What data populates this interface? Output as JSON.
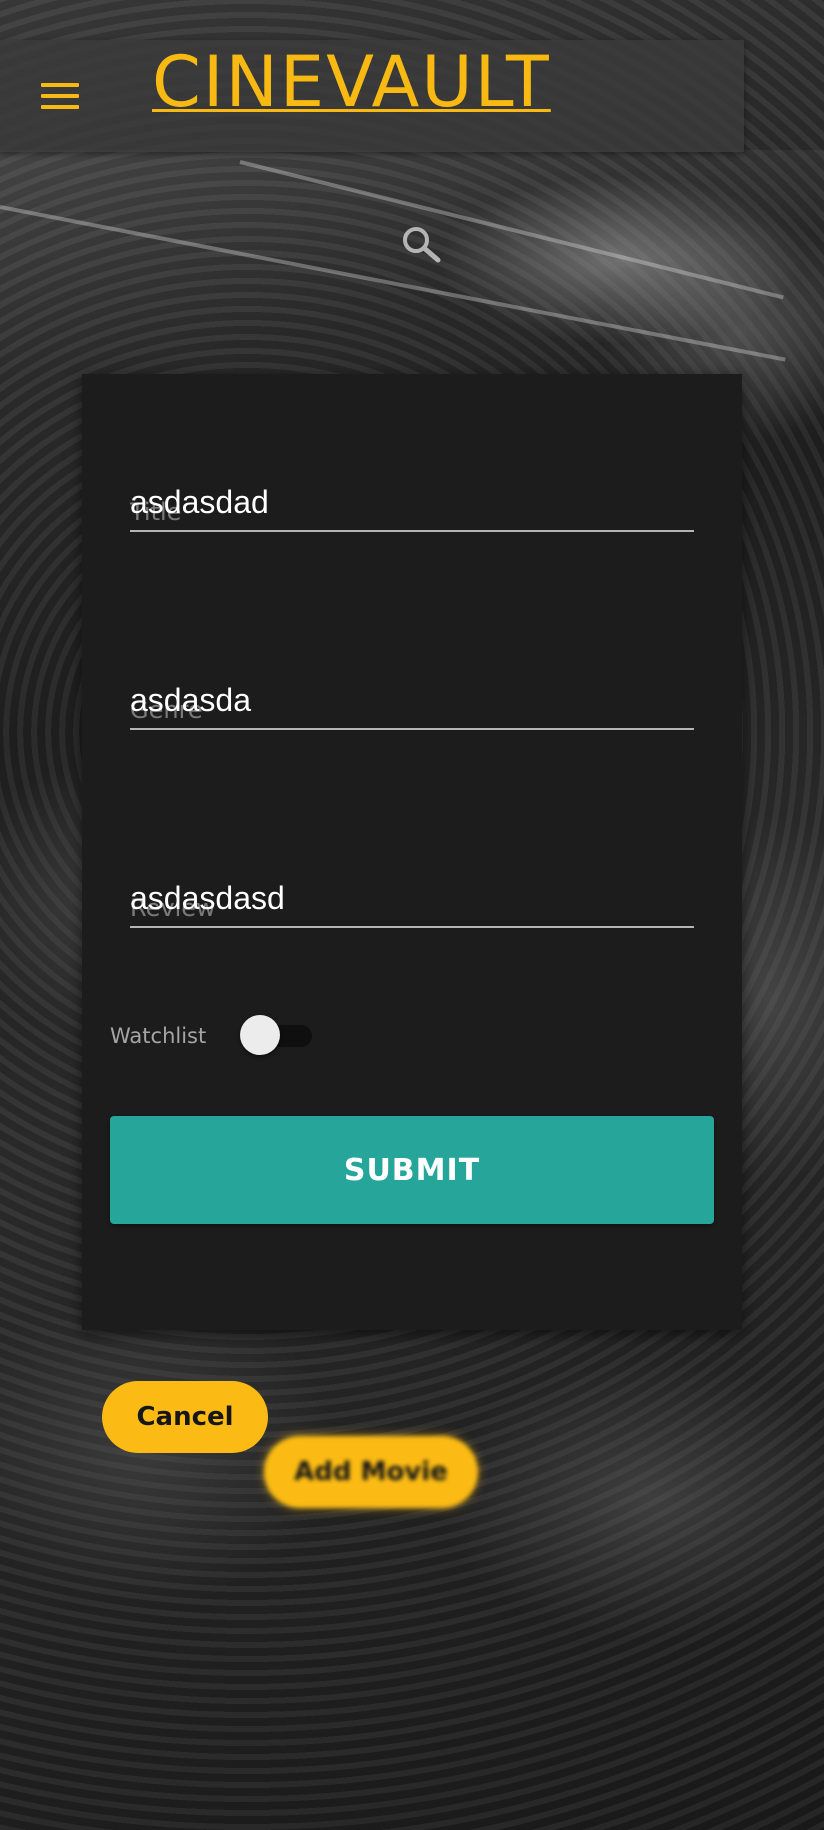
{
  "header": {
    "brand": "CINEVAULT",
    "menu_icon": "hamburger-menu-icon",
    "search_icon": "search-icon",
    "accent_color": "#f7b912"
  },
  "form": {
    "fields": [
      {
        "label": "Title",
        "value": "asdasdad"
      },
      {
        "label": "Genre",
        "value": "asdasda"
      },
      {
        "label": "Review",
        "value": "asdasdasd"
      }
    ],
    "watchlist": {
      "label": "Watchlist",
      "checked": false
    },
    "submit_label": "SUBMIT",
    "submit_color": "#26a69a"
  },
  "actions": {
    "cancel_label": "Cancel",
    "add_movie_label": "Add Movie",
    "button_color": "#fbbb14"
  }
}
